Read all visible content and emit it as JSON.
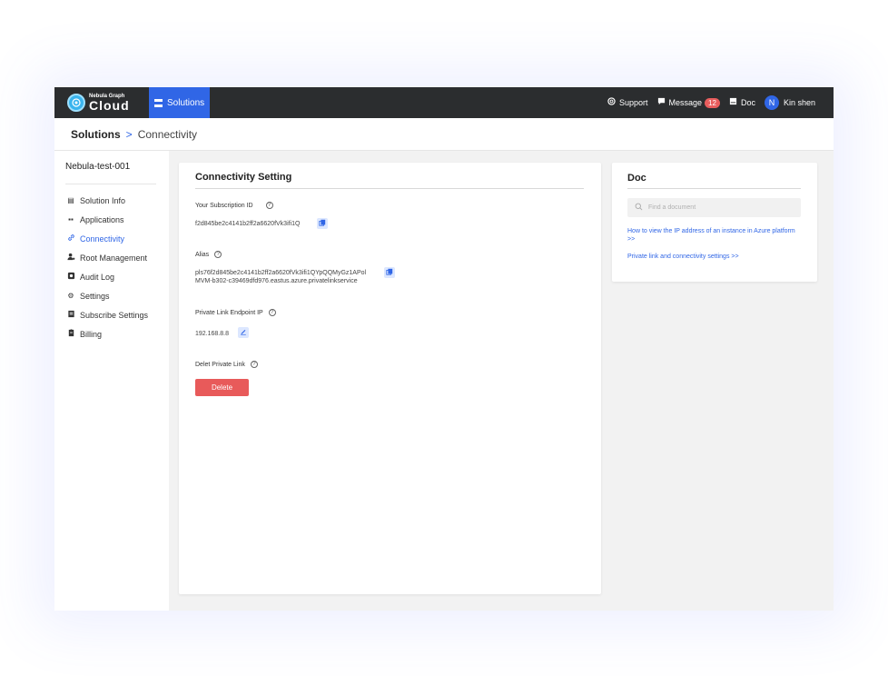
{
  "topbar": {
    "logo_small": "Nebula Graph",
    "logo_big": "Cloud",
    "nav_solutions": "Solutions",
    "support": "Support",
    "message": "Message",
    "message_count": "12",
    "doc": "Doc",
    "avatar_initial": "N",
    "user_name": "Kin shen"
  },
  "breadcrumb": {
    "root": "Solutions",
    "separator": ">",
    "current": "Connectivity"
  },
  "sidebar": {
    "title": "Nebula-test-001",
    "items": [
      {
        "label": "Solution Info",
        "icon": "document-icon"
      },
      {
        "label": "Applications",
        "icon": "grid-icon"
      },
      {
        "label": "Connectivity",
        "icon": "link-icon",
        "active": true
      },
      {
        "label": "Root Management",
        "icon": "user-gear-icon"
      },
      {
        "label": "Audit Log",
        "icon": "log-icon"
      },
      {
        "label": "Settings",
        "icon": "gear-icon"
      },
      {
        "label": "Subscribe Settings",
        "icon": "subscribe-icon"
      },
      {
        "label": "Billing",
        "icon": "billing-icon"
      }
    ]
  },
  "main": {
    "title": "Connectivity Setting",
    "subscription_label": "Your Subscription ID",
    "subscription_value": "f2d845be2c4141b2ff2a6620fVk3ifi1Q",
    "alias_label": "Alias",
    "alias_value_line1": "pls76f2d845be2c4141b2ff2a6620fVk3ifi1QYpQQMyGz1APol",
    "alias_value_line2": "MVM-b302-c39469dfd976.eastus.azure.privatelinkservice",
    "endpoint_label": "Private Link Endpoint IP",
    "endpoint_value": "192.168.8.8",
    "delete_label": "Delet Private Link",
    "delete_button": "Delete"
  },
  "doc": {
    "title": "Doc",
    "search_placeholder": "Find a document",
    "links": [
      "How to view the IP address of an instance in Azure platform >>",
      "Private link and connectivity settings >>"
    ]
  },
  "colors": {
    "accent": "#3066e6",
    "topbar": "#2b2d2f",
    "danger": "#e85a5a"
  }
}
